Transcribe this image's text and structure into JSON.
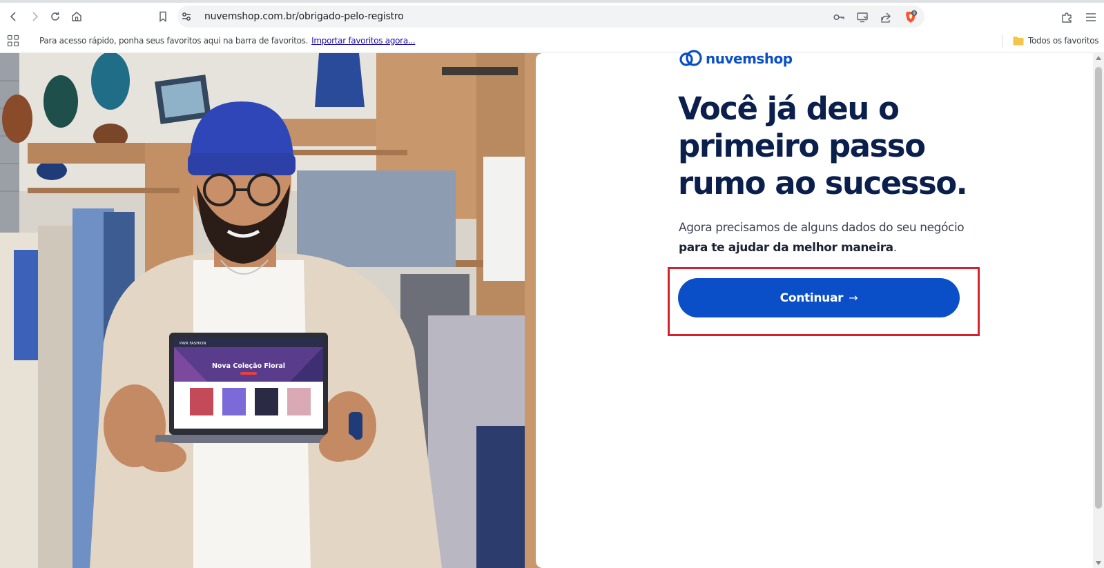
{
  "browser": {
    "url": "nuvemshop.com.br/obrigado-pelo-registro",
    "brave_badge_count": "9",
    "bookmarks_bar": {
      "hint_text": "Para acesso rápido, ponha seus favoritos aqui na barra de favoritos.",
      "import_link": "Importar favoritos agora...",
      "all_bookmarks": "Todos os favoritos"
    },
    "colors": {
      "brave_orange": "#fb542b",
      "folder_yellow": "#f5c44b"
    }
  },
  "page": {
    "brand": "nuvemshop",
    "headline": [
      "Você já deu o",
      "primeiro passo",
      "rumo ao sucesso."
    ],
    "subtext_plain": "Agora precisamos de alguns dados do seu negócio",
    "subtext_bold": "para te ajudar da melhor maneira",
    "subtext_end": ".",
    "cta_label": "Continuar",
    "cta_arrow": "→",
    "laptop_screen": {
      "store_name": "PWR FASHION",
      "banner": "Nova Coleção Floral"
    },
    "colors": {
      "primary": "#0a4fc7",
      "headline": "#0b1f4d",
      "highlight_border": "#d6202c"
    }
  }
}
